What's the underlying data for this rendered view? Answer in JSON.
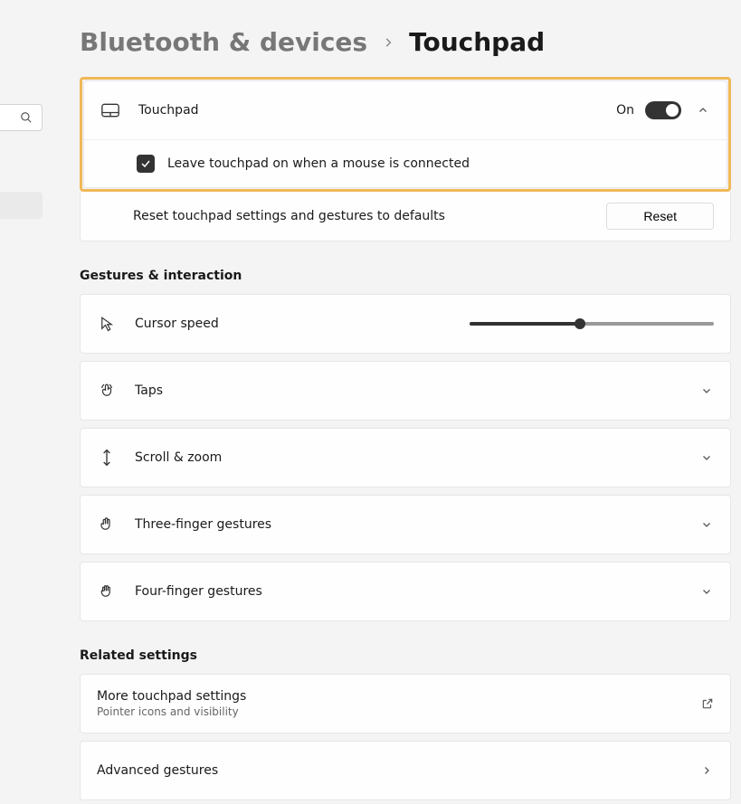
{
  "breadcrumb": {
    "parent": "Bluetooth & devices",
    "current": "Touchpad"
  },
  "touchpad": {
    "title": "Touchpad",
    "toggle_state_label": "On",
    "leave_on_label": "Leave touchpad on when a mouse is connected",
    "reset_label": "Reset touchpad settings and gestures to defaults",
    "reset_button": "Reset"
  },
  "sections": {
    "gestures_header": "Gestures & interaction",
    "related_header": "Related settings"
  },
  "cursor_speed": {
    "label": "Cursor speed",
    "value_pct": 45
  },
  "rows": {
    "taps": "Taps",
    "scroll_zoom": "Scroll & zoom",
    "three_finger": "Three-finger gestures",
    "four_finger": "Four-finger gestures"
  },
  "related": {
    "more": {
      "title": "More touchpad settings",
      "sub": "Pointer icons and visibility"
    },
    "advanced": {
      "title": "Advanced gestures"
    }
  }
}
